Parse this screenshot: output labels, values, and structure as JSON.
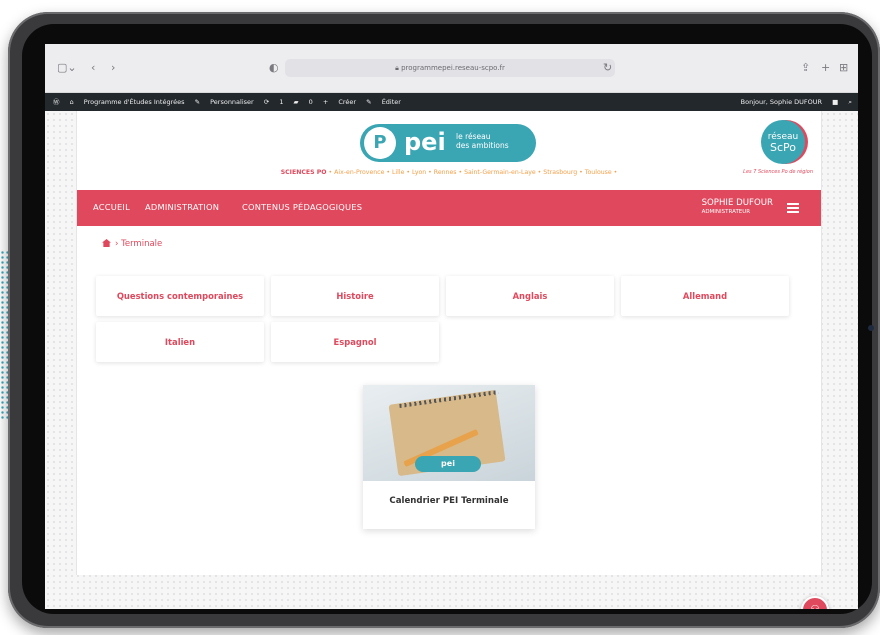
{
  "safari": {
    "url": "programmepei.reseau-scpo.fr",
    "icons": [
      "sidebar-icon",
      "back-icon",
      "forward-icon",
      "shield-icon",
      "lock-icon",
      "reload-icon",
      "share-icon",
      "new-tab-icon",
      "tabs-icon"
    ]
  },
  "wp_bar": {
    "site": "Programme d'Études Intégrées",
    "customize": "Personnaliser",
    "updates": "1",
    "comments": "0",
    "create": "Créer",
    "edit": "Éditer",
    "greeting": "Bonjour, Sophie DUFOUR"
  },
  "header": {
    "logo_word": "pei",
    "logo_tagline_1": "le réseau",
    "logo_tagline_2": "des ambitions",
    "cities_prefix": "SCIENCES PO",
    "cities": "• Aix-en-Provence • Lille • Lyon • Rennes • Saint-Germain-en-Laye • Strasbourg • Toulouse •",
    "scpo_line1": "réseau",
    "scpo_line2": "ScPo",
    "scpo_tagline": "Les 7 Sciences Po de région"
  },
  "nav": {
    "items": [
      "ACCUEIL",
      "ADMINISTRATION",
      "CONTENUS PÉDAGOGIQUES"
    ],
    "user_name": "SOPHIE DUFOUR",
    "user_role": "ADMINISTRATEUR"
  },
  "breadcrumb": {
    "current": "Terminale"
  },
  "subjects": [
    "Questions contemporaines",
    "Histoire",
    "Anglais",
    "Allemand",
    "Italien",
    "Espagnol"
  ],
  "card": {
    "title": "Calendrier PEI Terminale",
    "image_badge": "pei"
  },
  "colors": {
    "accent": "#e0495d",
    "teal": "#3aa5b3",
    "cities": "#f3a04a"
  }
}
